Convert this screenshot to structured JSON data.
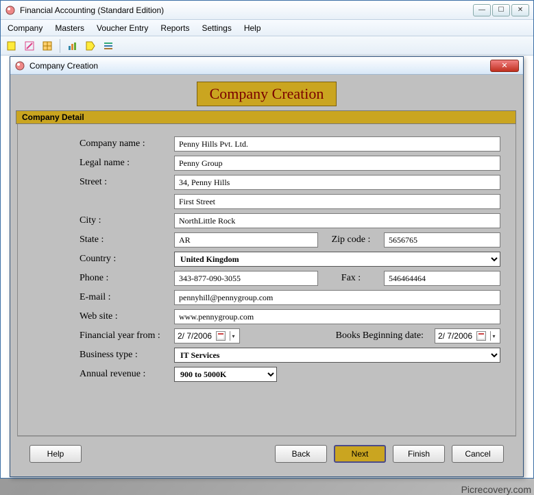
{
  "window": {
    "title": "Financial Accounting (Standard Edition)",
    "menu": [
      "Company",
      "Masters",
      "Voucher Entry",
      "Reports",
      "Settings",
      "Help"
    ]
  },
  "dialog": {
    "title": "Company Creation",
    "heading": "Company Creation",
    "tab": "Company Detail"
  },
  "labels": {
    "company_name": "Company name :",
    "legal_name": "Legal name :",
    "street": "Street :",
    "city": "City :",
    "state": "State :",
    "zip": "Zip code :",
    "country": "Country :",
    "phone": "Phone :",
    "fax": "Fax :",
    "email": "E-mail :",
    "website": "Web site :",
    "fin_from": "Financial year from :",
    "books_begin": "Books Beginning date:",
    "biz_type": "Business type :",
    "annual_rev": "Annual revenue :"
  },
  "values": {
    "company_name": "Penny Hills Pvt. Ltd.",
    "legal_name": "Penny Group",
    "street1": "34, Penny Hills",
    "street2": "First Street",
    "city": "NorthLittle Rock",
    "state": "AR",
    "zip": "5656765",
    "country": "United Kingdom",
    "phone": "343-877-090-3055",
    "fax": "546464464",
    "email": "pennyhill@pennygroup.com",
    "website": "www.pennygroup.com",
    "fin_from": "2/  7/2006",
    "books_begin": "2/  7/2006",
    "biz_type": "IT Services",
    "annual_rev": "900 to 5000K"
  },
  "buttons": {
    "help": "Help",
    "back": "Back",
    "next": "Next",
    "finish": "Finish",
    "cancel": "Cancel"
  },
  "toolbar_icons": [
    "new-file-icon",
    "edit-icon",
    "grid-icon",
    "chart-icon",
    "tag-icon",
    "list-icon"
  ],
  "watermark": "Picrecovery.com"
}
